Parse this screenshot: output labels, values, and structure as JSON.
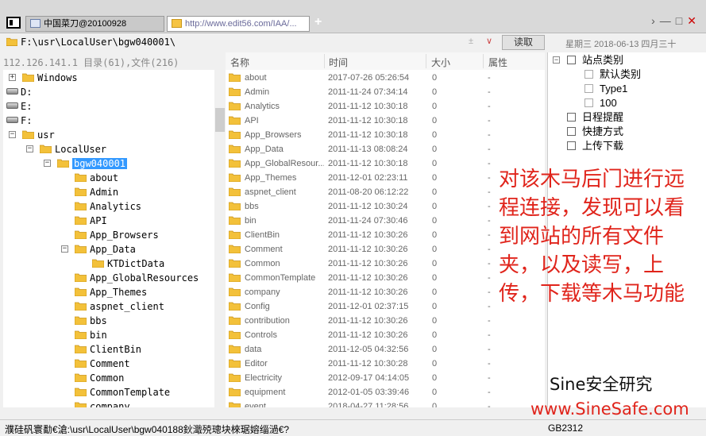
{
  "tabs": [
    {
      "label": "中国菜刀@20100928"
    },
    {
      "label": "http://www.edit56.com/IAA/..."
    }
  ],
  "window_controls": {
    "chevron": "›",
    "minimize": "—",
    "maximize": "□",
    "close": "✕"
  },
  "address": {
    "path": "F:\\usr\\LocalUser\\bgw040001\\",
    "read_button": "读取",
    "date": "星期三 2018-06-13 四月三十"
  },
  "info": {
    "text": "112.126.141.1  目录(61),文件(216)"
  },
  "tree": [
    {
      "label": "Windows",
      "kind": "folder",
      "expander": "+"
    },
    {
      "label": "D:",
      "kind": "drive"
    },
    {
      "label": "E:",
      "kind": "drive"
    },
    {
      "label": "F:",
      "kind": "drive"
    },
    {
      "label": "usr",
      "kind": "folder",
      "expander": "−"
    },
    {
      "label": "LocalUser",
      "kind": "folder",
      "expander": "−"
    },
    {
      "label": "bgw040001",
      "kind": "folder",
      "expander": "−",
      "selected": true
    },
    {
      "label": "about",
      "kind": "folder"
    },
    {
      "label": "Admin",
      "kind": "folder"
    },
    {
      "label": "Analytics",
      "kind": "folder"
    },
    {
      "label": "API",
      "kind": "folder"
    },
    {
      "label": "App_Browsers",
      "kind": "folder"
    },
    {
      "label": "App_Data",
      "kind": "folder",
      "expander": "−"
    },
    {
      "label": "KTDictData",
      "kind": "folder"
    },
    {
      "label": "App_GlobalResources",
      "kind": "folder"
    },
    {
      "label": "App_Themes",
      "kind": "folder"
    },
    {
      "label": "aspnet_client",
      "kind": "folder"
    },
    {
      "label": "bbs",
      "kind": "folder"
    },
    {
      "label": "bin",
      "kind": "folder"
    },
    {
      "label": "ClientBin",
      "kind": "folder"
    },
    {
      "label": "Comment",
      "kind": "folder"
    },
    {
      "label": "Common",
      "kind": "folder"
    },
    {
      "label": "CommonTemplate",
      "kind": "folder"
    },
    {
      "label": "company",
      "kind": "folder"
    }
  ],
  "list_headers": {
    "name": "名称",
    "time": "时间",
    "size": "大小",
    "attr": "属性"
  },
  "files": [
    {
      "name": "about",
      "time": "2017-07-26 05:26:54",
      "size": "0",
      "attr": "-"
    },
    {
      "name": "Admin",
      "time": "2011-11-24 07:34:14",
      "size": "0",
      "attr": "-"
    },
    {
      "name": "Analytics",
      "time": "2011-11-12 10:30:18",
      "size": "0",
      "attr": "-"
    },
    {
      "name": "API",
      "time": "2011-11-12 10:30:18",
      "size": "0",
      "attr": "-"
    },
    {
      "name": "App_Browsers",
      "time": "2011-11-12 10:30:18",
      "size": "0",
      "attr": "-"
    },
    {
      "name": "App_Data",
      "time": "2011-11-13 08:08:24",
      "size": "0",
      "attr": "-"
    },
    {
      "name": "App_GlobalResour...",
      "time": "2011-11-12 10:30:18",
      "size": "0",
      "attr": "-"
    },
    {
      "name": "App_Themes",
      "time": "2011-12-01 02:23:11",
      "size": "0",
      "attr": "-"
    },
    {
      "name": "aspnet_client",
      "time": "2011-08-20 06:12:22",
      "size": "0",
      "attr": "-"
    },
    {
      "name": "bbs",
      "time": "2011-11-12 10:30:24",
      "size": "0",
      "attr": "-"
    },
    {
      "name": "bin",
      "time": "2011-11-24 07:30:46",
      "size": "0",
      "attr": "-"
    },
    {
      "name": "ClientBin",
      "time": "2011-11-12 10:30:26",
      "size": "0",
      "attr": "-"
    },
    {
      "name": "Comment",
      "time": "2011-11-12 10:30:26",
      "size": "0",
      "attr": "-"
    },
    {
      "name": "Common",
      "time": "2011-11-12 10:30:26",
      "size": "0",
      "attr": "-"
    },
    {
      "name": "CommonTemplate",
      "time": "2011-11-12 10:30:26",
      "size": "0",
      "attr": "-"
    },
    {
      "name": "company",
      "time": "2011-11-12 10:30:26",
      "size": "0",
      "attr": "-"
    },
    {
      "name": "Config",
      "time": "2011-12-01 02:37:15",
      "size": "0",
      "attr": "-"
    },
    {
      "name": "contribution",
      "time": "2011-11-12 10:30:26",
      "size": "0",
      "attr": "-"
    },
    {
      "name": "Controls",
      "time": "2011-11-12 10:30:26",
      "size": "0",
      "attr": "-"
    },
    {
      "name": "data",
      "time": "2011-12-05 04:32:56",
      "size": "0",
      "attr": "-"
    },
    {
      "name": "Editor",
      "time": "2011-11-12 10:30:28",
      "size": "0",
      "attr": "-"
    },
    {
      "name": "Electricity",
      "time": "2012-09-17 04:14:05",
      "size": "0",
      "attr": "-"
    },
    {
      "name": "equipment",
      "time": "2012-01-05 03:39:46",
      "size": "0",
      "attr": "-"
    },
    {
      "name": "event",
      "time": "2018-04-27 11:28:56",
      "size": "0",
      "attr": "-"
    }
  ],
  "right_panel": [
    {
      "label": "站点类别",
      "indent": 0,
      "expander": "−"
    },
    {
      "label": "默认类别",
      "indent": 1
    },
    {
      "label": "Type1",
      "indent": 1
    },
    {
      "label": "100",
      "indent": 1
    },
    {
      "label": "日程提醒",
      "indent": 0
    },
    {
      "label": "快捷方式",
      "indent": 0
    },
    {
      "label": "上传下载",
      "indent": 0
    }
  ],
  "annotation": "对该木马后门进行远程连接，发现可以看到网站的所有文件夹，以及读写，上传，下载等木马功能",
  "watermark": {
    "line1": "Sine安全研究",
    "line2": "www.SineSafe.com"
  },
  "status": {
    "text": "濮硅矾寰勫€滄:\\usr\\LocalUser\\bgw040188鈥濈殑璁块棶琚嫆缁濄€?",
    "encoding": "GB2312"
  },
  "colors": {
    "folder": "#f3c13a",
    "selection": "#3399ff",
    "annotation": "#e0241b"
  }
}
